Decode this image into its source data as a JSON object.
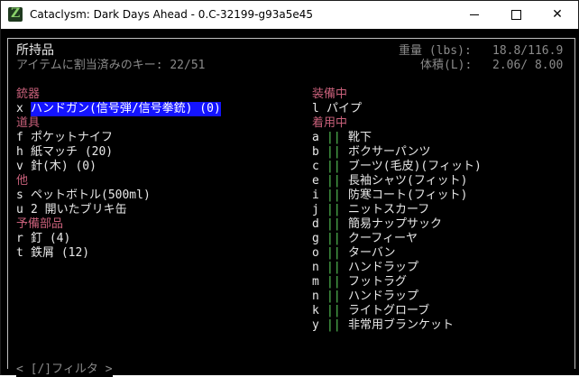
{
  "window": {
    "title": "Cataclysm: Dark Days Ahead - 0.C-32199-g93a5e45",
    "minimize_glyph": "—",
    "close_glyph": "✕",
    "icon": "cataclysm-z-icon"
  },
  "header": {
    "title": "所持品",
    "subtitle": "アイテムに割当済みのキー: 22/51",
    "weight_label": "重量 (lbs):",
    "weight_value": "18.8/116.9",
    "volume_label": "体積(L):",
    "volume_value": "2.06/ 8.00"
  },
  "left": {
    "groups": [
      {
        "category": "銃器",
        "items": [
          {
            "key": "x",
            "label": "ハンドガン(信号弾/信号拳銃) (0)",
            "selected": true
          }
        ]
      },
      {
        "category": "道具",
        "items": [
          {
            "key": "f",
            "label": "ポケットナイフ"
          },
          {
            "key": "h",
            "label": "紙マッチ (20)"
          },
          {
            "key": "v",
            "label": "針(木) (0)"
          }
        ]
      },
      {
        "category": "他",
        "items": [
          {
            "key": "s",
            "label": "ペットボトル(500ml)"
          },
          {
            "key": "u",
            "label": "2 開いたブリキ缶"
          }
        ]
      },
      {
        "category": "予備部品",
        "items": [
          {
            "key": "r",
            "label": "釘 (4)"
          },
          {
            "key": "t",
            "label": "鉄屑 (12)"
          }
        ]
      }
    ]
  },
  "right": {
    "wielded_category": "装備中",
    "wielded": [
      {
        "key": "l",
        "label": "パイプ"
      }
    ],
    "worn_category": "着用中",
    "worn_marker": "||",
    "worn": [
      {
        "key": "a",
        "label": "靴下"
      },
      {
        "key": "b",
        "label": "ボクサーパンツ"
      },
      {
        "key": "c",
        "label": "ブーツ(毛皮)(フィット)"
      },
      {
        "key": "e",
        "label": "長袖シャツ(フィット)"
      },
      {
        "key": "i",
        "label": "防寒コート(フィット)"
      },
      {
        "key": "j",
        "label": "ニットスカーフ"
      },
      {
        "key": "d",
        "label": "簡易ナップサック"
      },
      {
        "key": "g",
        "label": "クーフィーヤ"
      },
      {
        "key": "o",
        "label": "ターバン"
      },
      {
        "key": "n",
        "label": "ハンドラップ"
      },
      {
        "key": "m",
        "label": "フットラグ"
      },
      {
        "key": "n",
        "label": "ハンドラップ"
      },
      {
        "key": "k",
        "label": "ライトグローブ"
      },
      {
        "key": "y",
        "label": "非常用ブランケット"
      }
    ]
  },
  "footer": {
    "filter_hint": "< [/]フィルタ >"
  }
}
